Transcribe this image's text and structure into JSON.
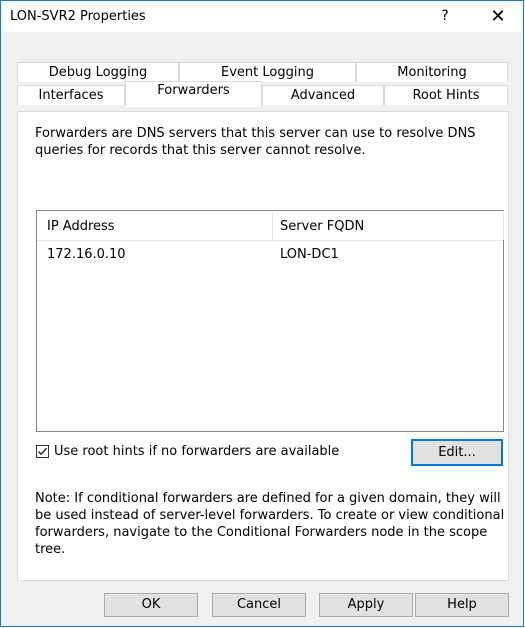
{
  "window": {
    "title": "LON-SVR2 Properties",
    "help_glyph": "?",
    "close_glyph": "✕"
  },
  "tabs_row1": [
    "Debug Logging",
    "Event Logging",
    "Monitoring"
  ],
  "tabs_row2": [
    "Interfaces",
    "Forwarders",
    "Advanced",
    "Root Hints"
  ],
  "active_tab": "Forwarders",
  "description": "Forwarders are DNS servers that this server can use to resolve DNS queries for records that this server cannot resolve.",
  "forwarders": {
    "columns": [
      "IP Address",
      "Server FQDN"
    ],
    "rows": [
      {
        "ip": "172.16.0.10",
        "fqdn": "LON-DC1"
      }
    ]
  },
  "root_hints_checkbox": {
    "label": "Use root hints if no forwarders are available",
    "checked": true
  },
  "edit_button": "Edit...",
  "note": "Note: If conditional forwarders are defined for a given domain, they will be used instead of server-level forwarders.  To create or view conditional forwarders, navigate to the Conditional Forwarders node in the scope tree.",
  "buttons": {
    "ok": "OK",
    "cancel": "Cancel",
    "apply": "Apply",
    "help": "Help"
  },
  "colors": {
    "accent": "#0078d7",
    "window_border": "#1979ca",
    "background": "#f0f0f0"
  }
}
